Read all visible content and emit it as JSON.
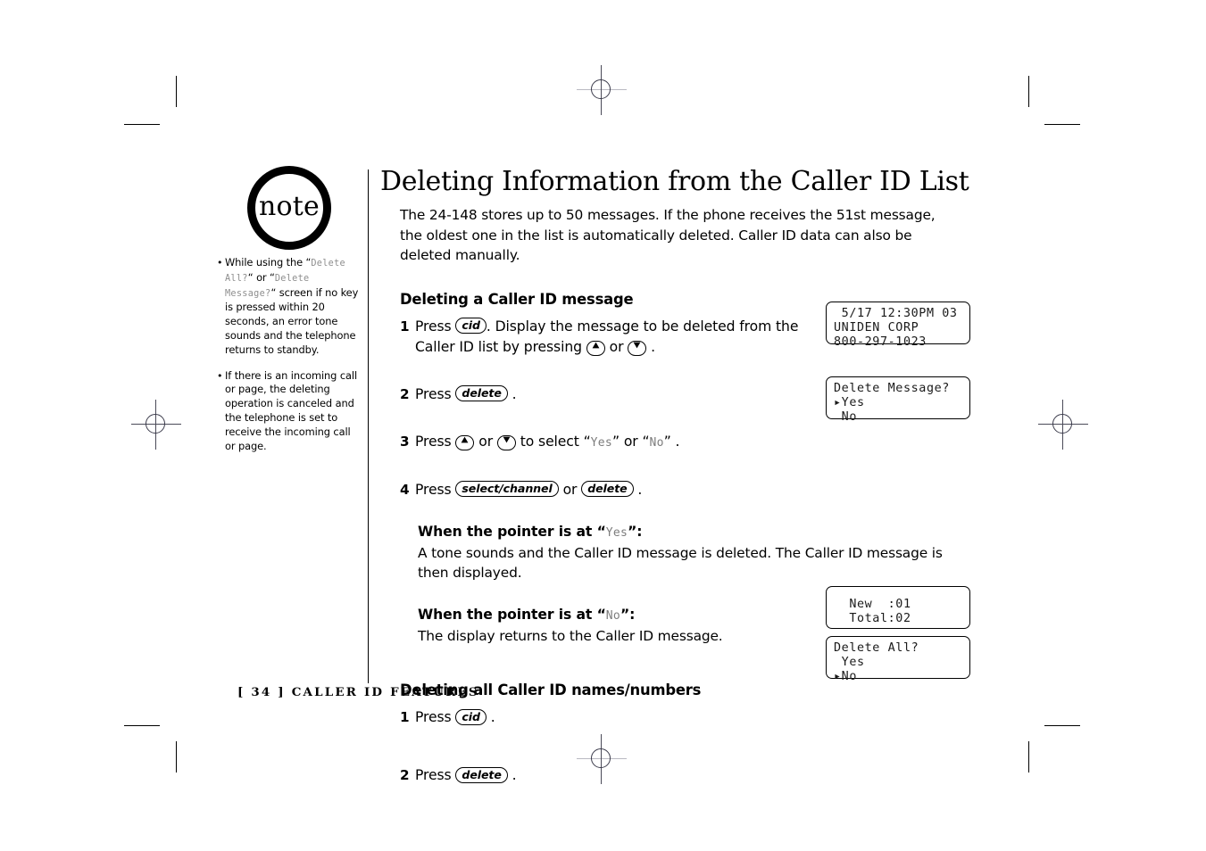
{
  "page": {
    "footer": "[ 34 ]  CALLER ID FEATURES",
    "note_badge": "note"
  },
  "sidebar": {
    "notes": [
      {
        "bullet": "•",
        "parts": [
          {
            "type": "text",
            "value": "While using the "
          },
          {
            "type": "quote_open",
            "value": "“"
          },
          {
            "type": "lcd",
            "value": "Delete All?"
          },
          {
            "type": "quote_close",
            "value": "“"
          },
          {
            "type": "text",
            "value": " or "
          },
          {
            "type": "quote_open2",
            "value": "“"
          },
          {
            "type": "lcd2",
            "value": "Delete Message?"
          },
          {
            "type": "quote_close2",
            "value": "“"
          },
          {
            "type": "tail",
            "value": " screen if no key is pressed within 20 seconds, an error  tone sounds and the telephone returns to standby."
          }
        ]
      },
      {
        "bullet": "•",
        "parts": [
          {
            "type": "tail",
            "value": "If there is an incoming call or page, the deleting operation is canceled and the telephone is set to receive the incoming call or page."
          }
        ]
      }
    ]
  },
  "main": {
    "title": "Deleting Information from the Caller ID List",
    "intro": "The 24-148 stores up to 50 messages. If the phone receives the 51st message, the oldest one in the list is automatically deleted. Caller ID data can also be deleted manually.",
    "section1": {
      "heading": "Deleting a Caller ID message",
      "steps": [
        {
          "num": "1",
          "text_before": "Press ",
          "key": "cid",
          "text_mid": ". Display the message to be deleted from the Caller ID list by pressing ",
          "arrow_up": "▲",
          "text_or": " or ",
          "arrow_down": "▼",
          "text_after": " ."
        },
        {
          "num": "2",
          "text_before": "Press ",
          "key": "delete",
          "text_after": " ."
        },
        {
          "num": "3",
          "text_before": "Press ",
          "arrow_up": "▲",
          "text_or": " or ",
          "arrow_down": "▼",
          "text_mid": " to select “",
          "lcd_yes": "Yes",
          "text_mid2": "”  or  “",
          "lcd_no": "No",
          "text_after": "” ."
        },
        {
          "num": "4",
          "text_before": "Press ",
          "key": "select/channel",
          "text_mid": " or ",
          "key2": "delete",
          "text_after": " ."
        }
      ],
      "pointer_blocks": [
        {
          "head_before": "When the pointer is at “",
          "head_lcd": "Yes",
          "head_after": "”:",
          "body": "A tone sounds and the Caller ID message is deleted. The Caller ID message is then displayed."
        },
        {
          "head_before": "When the pointer is at “",
          "head_lcd": "No",
          "head_after": "”:",
          "body": "The display returns to the Caller ID message."
        }
      ]
    },
    "section2": {
      "heading": "Deleting all Caller ID names/numbers",
      "steps": [
        {
          "num": "1",
          "text_before": "Press ",
          "key": "cid",
          "text_after": " ."
        },
        {
          "num": "2",
          "text_before": "Press ",
          "key": "delete",
          "text_after": " ."
        }
      ]
    }
  },
  "displays": [
    {
      "name": "caller-id-message-display",
      "lines": [
        " 5/17 12:30PM 03",
        "UNIDEN CORP",
        "800-297-1023"
      ]
    },
    {
      "name": "delete-message-prompt-display",
      "lines": [
        "Delete Message?",
        "▸Yes",
        " No"
      ]
    },
    {
      "name": "call-counts-display",
      "lines": [
        "  New  :01",
        "  Total:02"
      ]
    },
    {
      "name": "delete-all-prompt-display",
      "lines": [
        "Delete All?",
        " Yes",
        "▸No"
      ]
    }
  ]
}
